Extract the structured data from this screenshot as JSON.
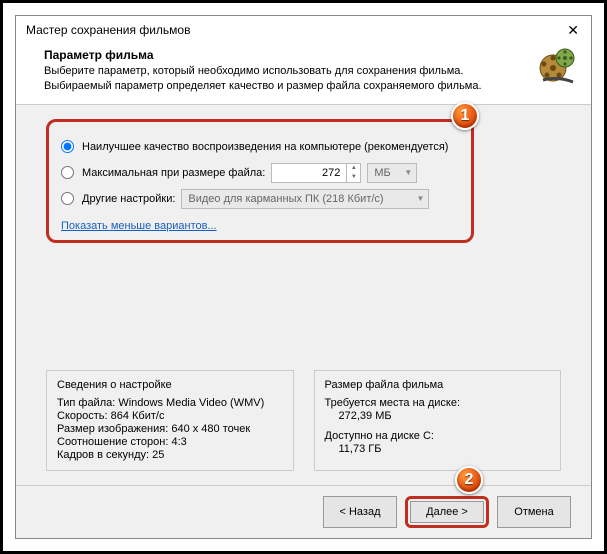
{
  "window": {
    "title": "Мастер сохранения фильмов"
  },
  "header": {
    "title": "Параметр фильма",
    "line1": "Выберите параметр, который необходимо использовать для сохранения фильма.",
    "line2": "Выбираемый параметр определяет качество и размер файла сохраняемого фильма."
  },
  "options": {
    "opt1": "Наилучшее качество воспроизведения на компьютере (рекомендуется)",
    "opt2": "Максимальная при размере файла:",
    "opt2_value": "272",
    "opt2_unit": "МБ",
    "opt3": "Другие настройки:",
    "opt3_value": "Видео для карманных ПК (218 Кбит/с)",
    "show_link": "Показать меньше вариантов..."
  },
  "details": {
    "left_title": "Сведения о настройке",
    "file_type": "Тип файла: Windows Media Video (WMV)",
    "bitrate": "Скорость: 864 Кбит/с",
    "resolution": "Размер изображения: 640 x 480 точек",
    "aspect": "Соотношение сторон: 4:3",
    "fps": "Кадров в секунду: 25",
    "right_title": "Размер файла фильма",
    "req_label": "Требуется места на диске:",
    "req_value": "272,39 МБ",
    "avail_label": "Доступно на диске C:",
    "avail_value": "11,73 ГБ"
  },
  "buttons": {
    "back": "< Назад",
    "next": "Далее >",
    "cancel": "Отмена"
  },
  "callouts": {
    "c1": "1",
    "c2": "2"
  }
}
